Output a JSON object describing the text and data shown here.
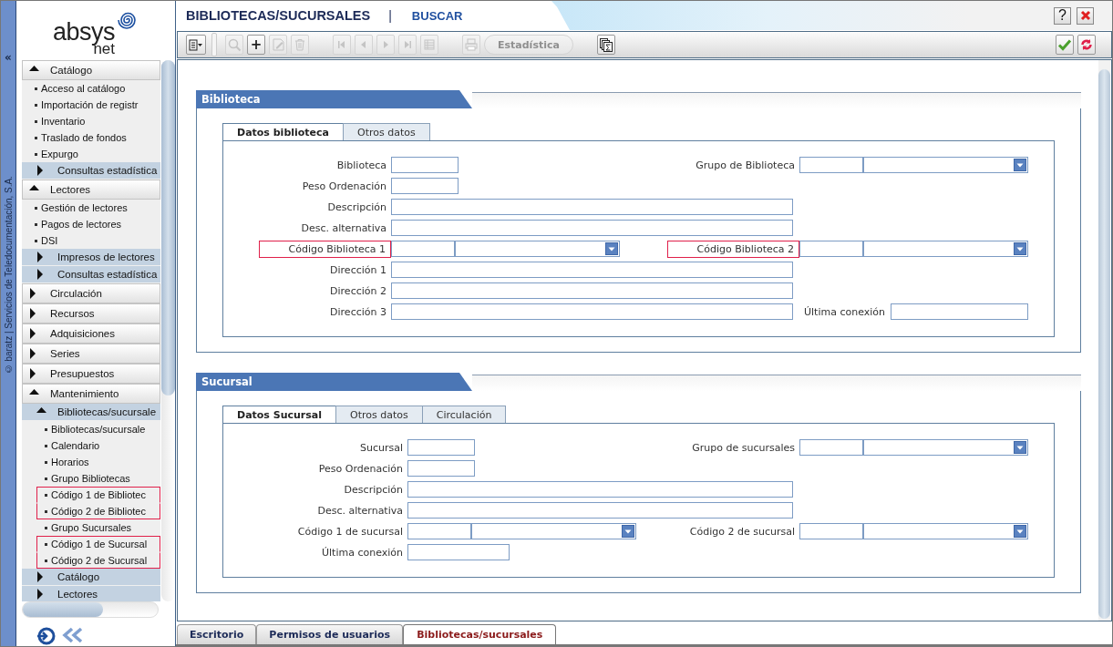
{
  "strip": {
    "collapse": "«",
    "copyright": "© baratz | Servicios de Teledocumentación, S.A."
  },
  "logo": {
    "name": "absys",
    "sub": "net"
  },
  "sidebar": {
    "items": [
      {
        "kind": "section",
        "label": "Catálogo",
        "expanded": true,
        "children": [
          {
            "kind": "link",
            "label": "Acceso al catálogo",
            "highlighted": false
          },
          {
            "kind": "link",
            "label": "Importación de registr",
            "highlighted": false
          },
          {
            "kind": "link",
            "label": "Inventario",
            "highlighted": false
          },
          {
            "kind": "link",
            "label": "Traslado de fondos",
            "highlighted": false
          },
          {
            "kind": "link",
            "label": "Expurgo",
            "highlighted": false
          },
          {
            "kind": "group",
            "label": "Consultas estadística",
            "expanded": false
          }
        ]
      },
      {
        "kind": "section",
        "label": "Lectores",
        "expanded": true,
        "children": [
          {
            "kind": "link",
            "label": "Gestión de lectores",
            "highlighted": false
          },
          {
            "kind": "link",
            "label": "Pagos de lectores",
            "highlighted": false
          },
          {
            "kind": "link",
            "label": "DSI",
            "highlighted": false
          },
          {
            "kind": "group",
            "label": "Impresos de lectores",
            "expanded": false
          },
          {
            "kind": "group",
            "label": "Consultas estadística",
            "expanded": false
          }
        ]
      },
      {
        "kind": "section",
        "label": "Circulación",
        "expanded": false
      },
      {
        "kind": "section",
        "label": "Recursos",
        "expanded": false
      },
      {
        "kind": "section",
        "label": "Adquisiciones",
        "expanded": false
      },
      {
        "kind": "section",
        "label": "Series",
        "expanded": false
      },
      {
        "kind": "section",
        "label": "Presupuestos",
        "expanded": false
      },
      {
        "kind": "section",
        "label": "Mantenimiento",
        "expanded": true,
        "children": [
          {
            "kind": "group",
            "label": "Bibliotecas/sucursale",
            "expanded": true,
            "children": [
              {
                "kind": "link",
                "label": "Bibliotecas/sucursale",
                "highlighted": false
              },
              {
                "kind": "link",
                "label": "Calendario",
                "highlighted": false
              },
              {
                "kind": "link",
                "label": "Horarios",
                "highlighted": false
              },
              {
                "kind": "link",
                "label": "Grupo Bibliotecas",
                "highlighted": false
              },
              {
                "kind": "link",
                "label": "Código 1 de Bibliotec",
                "highlighted": true
              },
              {
                "kind": "link",
                "label": "Código 2 de Bibliotec",
                "highlighted": true
              },
              {
                "kind": "link",
                "label": "Grupo Sucursales",
                "highlighted": false
              },
              {
                "kind": "link",
                "label": "Código 1 de Sucursal",
                "highlighted": true
              },
              {
                "kind": "link",
                "label": "Código 2 de Sucursal",
                "highlighted": true
              }
            ]
          },
          {
            "kind": "group",
            "label": "Catálogo",
            "expanded": false
          },
          {
            "kind": "group",
            "label": "Lectores",
            "expanded": false
          }
        ]
      }
    ]
  },
  "title_bar": {
    "title": "BIBLIOTECAS/SUCURSALES",
    "separator": "|",
    "mode": "BUSCAR",
    "help": "?"
  },
  "toolbar": {
    "groups": [
      {
        "buttons": [
          {
            "kind": "menu",
            "disabled": false
          }
        ]
      },
      {
        "buttons": [
          {
            "kind": "search",
            "disabled": true
          },
          {
            "kind": "add",
            "label": "+",
            "disabled": false
          },
          {
            "kind": "edit",
            "disabled": true
          },
          {
            "kind": "delete",
            "disabled": true
          }
        ]
      },
      {
        "buttons": [
          {
            "kind": "first",
            "disabled": true
          },
          {
            "kind": "previous",
            "disabled": true
          },
          {
            "kind": "next",
            "disabled": true
          },
          {
            "kind": "last",
            "disabled": true
          },
          {
            "kind": "grid",
            "disabled": true
          }
        ]
      },
      {
        "buttons": [
          {
            "kind": "print",
            "disabled": true
          },
          {
            "kind": "text",
            "label": "Estadística",
            "disabled": true
          }
        ]
      },
      {
        "buttons": [
          {
            "kind": "statistics",
            "disabled": false
          }
        ]
      }
    ],
    "actions": [
      {
        "kind": "accept",
        "disabled": false
      },
      {
        "kind": "cancel",
        "disabled": false
      }
    ]
  },
  "form_sections": [
    {
      "title": "Biblioteca",
      "tabs": [
        {
          "label": "Datos biblioteca",
          "selected": true
        },
        {
          "label": "Otros datos",
          "selected": false
        }
      ],
      "rows": [
        {
          "left": {
            "label": "Biblioteca",
            "kind": "short",
            "highlighted": false
          },
          "right": {
            "label": "Grupo de Biblioteca",
            "kind": "combo",
            "highlighted": false
          }
        },
        {
          "left": {
            "label": "Peso Ordenación",
            "kind": "short",
            "highlighted": false
          }
        },
        {
          "left": {
            "label": "Descripción",
            "kind": "long",
            "highlighted": false
          }
        },
        {
          "left": {
            "label": "Desc. alternativa",
            "kind": "long",
            "highlighted": false
          }
        },
        {
          "left": {
            "label": "Código Biblioteca 1",
            "kind": "combo",
            "highlighted": true
          },
          "right": {
            "label": "Código Biblioteca 2",
            "kind": "combo",
            "highlighted": true
          }
        },
        {
          "left": {
            "label": "Dirección 1",
            "kind": "long",
            "highlighted": false
          }
        },
        {
          "left": {
            "label": "Dirección 2",
            "kind": "long",
            "highlighted": false
          }
        },
        {
          "left": {
            "label": "Dirección 3",
            "kind": "long",
            "highlighted": false
          },
          "right": {
            "label": "Última conexión",
            "kind": "wide",
            "highlighted": false
          }
        }
      ]
    },
    {
      "title": "Sucursal",
      "tabs": [
        {
          "label": "Datos Sucursal",
          "selected": true
        },
        {
          "label": "Otros datos",
          "selected": false
        },
        {
          "label": "Circulación",
          "selected": false
        }
      ],
      "rows": [
        {
          "left": {
            "label": "Sucursal",
            "kind": "short",
            "highlighted": false
          },
          "right": {
            "label": "Grupo de sucursales",
            "kind": "combo",
            "highlighted": false
          }
        },
        {
          "left": {
            "label": "Peso Ordenación",
            "kind": "short",
            "highlighted": false
          }
        },
        {
          "left": {
            "label": "Descripción",
            "kind": "long",
            "highlighted": false
          }
        },
        {
          "left": {
            "label": "Desc. alternativa",
            "kind": "long",
            "highlighted": false
          }
        },
        {
          "left": {
            "label": "Código 1 de sucursal",
            "kind": "combo",
            "highlighted": false
          },
          "right": {
            "label": "Código 2 de sucursal",
            "kind": "combo",
            "highlighted": false
          }
        },
        {
          "left": {
            "label": "Última conexión",
            "kind": "medium",
            "highlighted": false
          }
        }
      ]
    }
  ],
  "bottom_tabs": [
    {
      "label": "Escritorio",
      "selected": false
    },
    {
      "label": "Permisos de usuarios",
      "selected": false
    },
    {
      "label": "Bibliotecas/sucursales",
      "selected": true
    }
  ]
}
